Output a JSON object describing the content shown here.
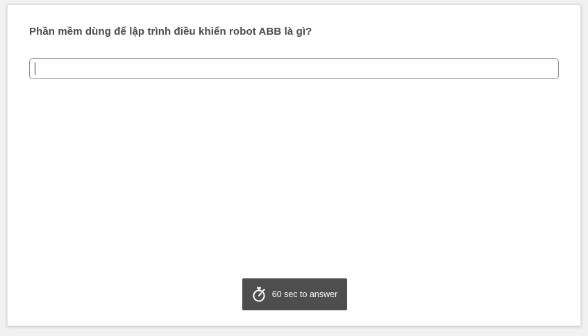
{
  "quiz": {
    "question": "Phần mềm dùng để lập trình điều khiển robot ABB là gì?",
    "answer": {
      "value": "",
      "placeholder": ""
    },
    "timer": {
      "icon": "stopwatch-icon",
      "label": "60 sec to answer"
    }
  },
  "colors": {
    "timer_bg": "#4e4e4e",
    "question_text": "#4a4a4a",
    "input_border": "#8f8f8f"
  }
}
